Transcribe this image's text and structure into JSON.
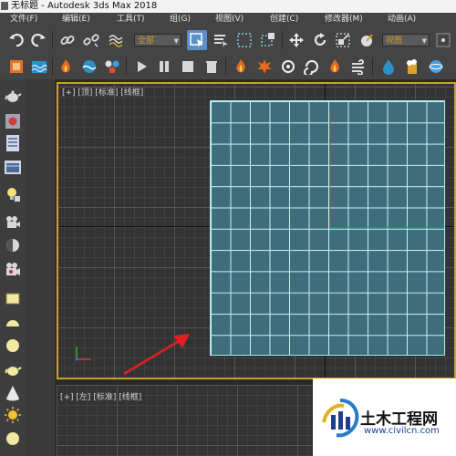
{
  "titlebar": {
    "title": "无标题 - Autodesk 3ds Max 2018"
  },
  "menubar": {
    "items": [
      {
        "label": "文件(F)"
      },
      {
        "label": "编辑(E)"
      },
      {
        "label": "工具(T)"
      },
      {
        "label": "组(G)"
      },
      {
        "label": "视图(V)"
      },
      {
        "label": "创建(C)"
      },
      {
        "label": "修改器(M)"
      },
      {
        "label": "动画(A)"
      }
    ]
  },
  "toolbar1": {
    "selection_filter": "全部",
    "coord_system": "视图"
  },
  "viewports": {
    "top": {
      "label": "[+] [顶] [标准] [线框]"
    },
    "left": {
      "label": "[+] [左] [标准] [线框]"
    }
  },
  "watermark": {
    "title": "土木工程网",
    "url": "www.civilcn.com"
  },
  "colors": {
    "active_viewport_border": "#c9a227",
    "plane_fill": "#3e6d7c",
    "plane_wire": "#cfeff3",
    "arrow": "#e02020"
  }
}
